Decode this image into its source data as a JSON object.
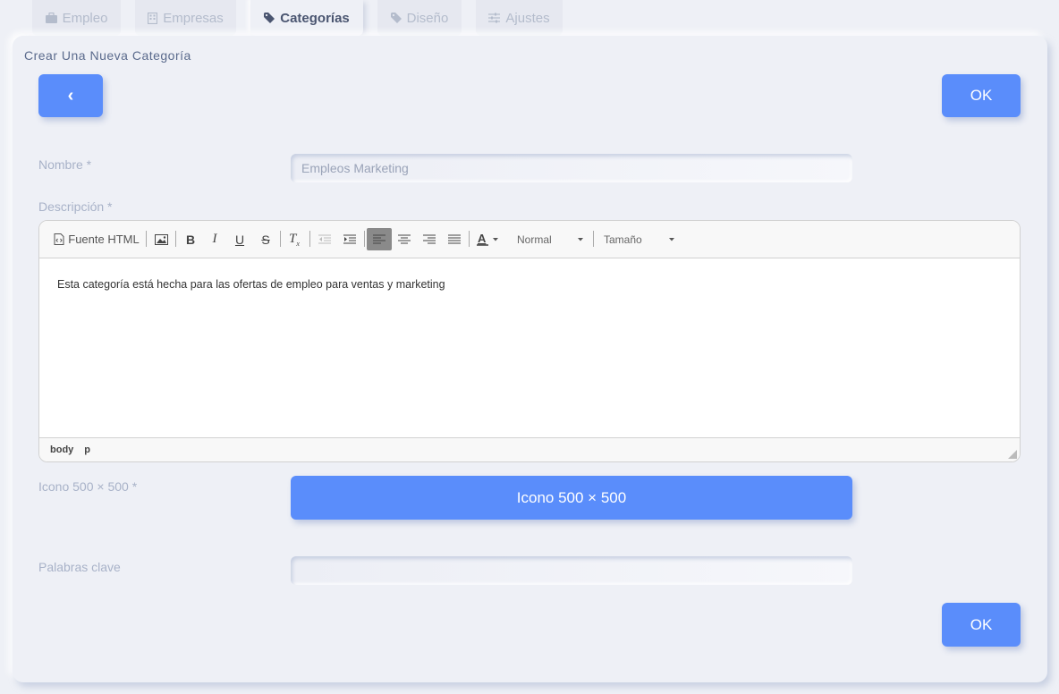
{
  "tabs": [
    {
      "label": "Empleo",
      "icon": "briefcase-icon",
      "active": false
    },
    {
      "label": "Empresas",
      "icon": "building-icon",
      "active": false
    },
    {
      "label": "Categorías",
      "icon": "tag-icon",
      "active": true
    },
    {
      "label": "Diseño",
      "icon": "tag-icon",
      "active": false
    },
    {
      "label": "Ajustes",
      "icon": "sliders-icon",
      "active": false
    }
  ],
  "page": {
    "title": "Crear Una Nueva Categoría",
    "back_label": "‹",
    "ok_label": "OK"
  },
  "form": {
    "name_label": "Nombre *",
    "name_value": "Empleos Marketing",
    "description_label": "Descripción *",
    "icon_label": "Icono 500 × 500 *",
    "icon_button": "Icono 500 × 500",
    "keywords_label": "Palabras clave",
    "keywords_value": ""
  },
  "editor": {
    "source_label": "Fuente HTML",
    "format_value": "Normal",
    "size_value": "Tamaño",
    "content": "Esta categoría está hecha para las ofertas de empleo para ventas y marketing",
    "path": [
      "body",
      "p"
    ]
  },
  "colors": {
    "background": "#eef0f6",
    "primary": "#5a8dfb",
    "label": "#a8b2c8"
  }
}
